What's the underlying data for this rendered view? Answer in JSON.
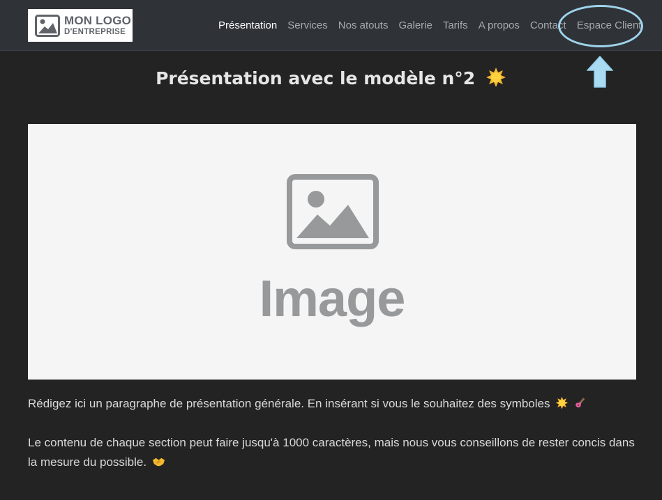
{
  "logo": {
    "line1": "MON LOGO",
    "line2": "D'ENTREPRISE"
  },
  "nav": {
    "items": [
      {
        "label": "Présentation",
        "active": true
      },
      {
        "label": "Services"
      },
      {
        "label": "Nos atouts"
      },
      {
        "label": "Galerie"
      },
      {
        "label": "Tarifs"
      },
      {
        "label": "A propos"
      },
      {
        "label": "Contact"
      },
      {
        "label": "Espace Client"
      }
    ]
  },
  "page": {
    "title": "Présentation avec le modèle n°2"
  },
  "image": {
    "label": "Image"
  },
  "content": {
    "paragraph1": "Rédigez ici un paragraphe de présentation générale. En insérant si vous le souhaitez des symboles",
    "paragraph2": "Le contenu de chaque section peut faire jusqu'à 1000 caractères, mais nous vous conseillons de rester concis dans la mesure du possible."
  },
  "icons": {
    "title": "sun-emoji",
    "p1": [
      "sun-emoji",
      "guitar-emoji"
    ],
    "p2": "handshake-emoji"
  },
  "colors": {
    "background": "#232323",
    "navbar": "#2f3338",
    "highlight": "#9fd3ec",
    "placeholder": "#97999b"
  }
}
